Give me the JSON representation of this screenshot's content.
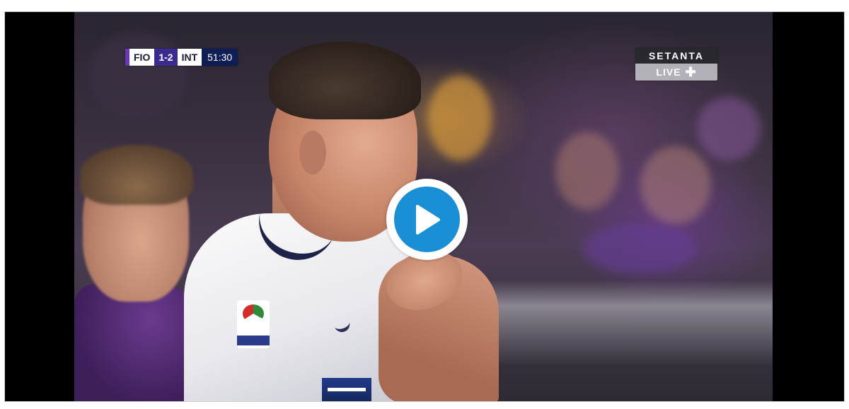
{
  "video": {
    "scoreboard": {
      "home_team": "FIO",
      "score": "1-2",
      "away_team": "INT",
      "match_time": "51:30",
      "colors": {
        "accent": "#6b38b5",
        "score_bg": "#3b2a8f",
        "time_bg": "#0f1d56"
      }
    },
    "channel": {
      "name": "SETANTA",
      "live_label": "LIVE",
      "icon": "plus-icon"
    },
    "play_button": {
      "icon": "play-icon",
      "color": "#1a8fd6"
    }
  }
}
